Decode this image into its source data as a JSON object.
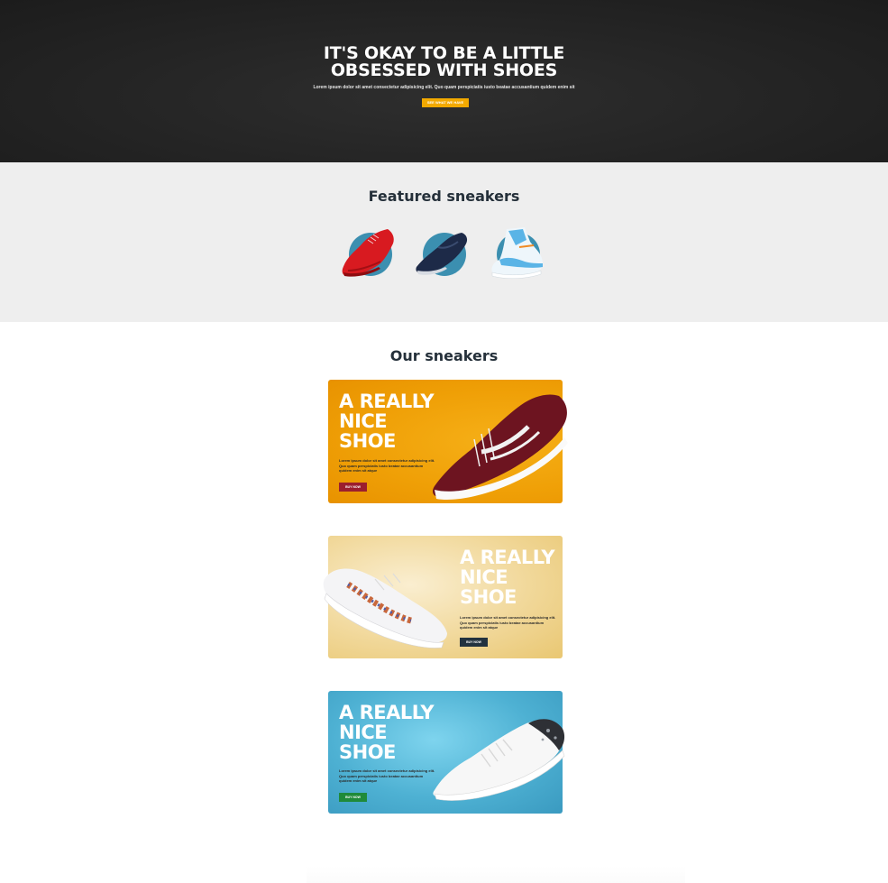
{
  "hero": {
    "title_line1": "IT'S OKAY TO BE A LITTLE",
    "title_line2": "OBSESSED WITH SHOES",
    "subtitle": "Lorem ipsum dolor sit amet consectetur adipisicing elit. Quo quam perspiciatis iusto beatae accusantium quidem enim sit",
    "cta_label": "SEE WHAT WE HAVE"
  },
  "featured": {
    "title": "Featured sneakers",
    "items": [
      {
        "icon": "red-sneaker-icon",
        "color": "#e0191f"
      },
      {
        "icon": "navy-sneaker-icon",
        "color": "#1d2a48"
      },
      {
        "icon": "blue-hightop-sneaker-icon",
        "color": "#5ab4e6"
      }
    ]
  },
  "ours": {
    "title": "Our sneakers",
    "cards": [
      {
        "heading_line1": "A REALLY",
        "heading_line2": "NICE",
        "heading_line3": "SHOE",
        "description": "Lorem ipsum dolor sit amet consectetur adipisicing elit. Quo quam perspiciatis iusto beatae accusantium quidem enim sit atque",
        "buy_label": "BUY NOW",
        "accent": "#9b1e2e",
        "background": "#ef9f06"
      },
      {
        "heading_line1": "A REALLY",
        "heading_line2": "NICE",
        "heading_line3": "SHOE",
        "description": "Lorem ipsum dolor sit amet consectetur adipisicing elit. Quo quam perspiciatis iusto beatae accusantium quidem enim sit atque",
        "buy_label": "BUY NOW",
        "accent": "#23323f",
        "background": "#f1d89a"
      },
      {
        "heading_line1": "A REALLY",
        "heading_line2": "NICE",
        "heading_line3": "SHOE",
        "description": "Lorem ipsum dolor sit amet consectetur adipisicing elit. Quo quam perspiciatis iusto beatae accusantium quidem enim sit atque",
        "buy_label": "BUY NOW",
        "accent": "#1f8a3a",
        "background": "#4eb1d3"
      }
    ]
  }
}
